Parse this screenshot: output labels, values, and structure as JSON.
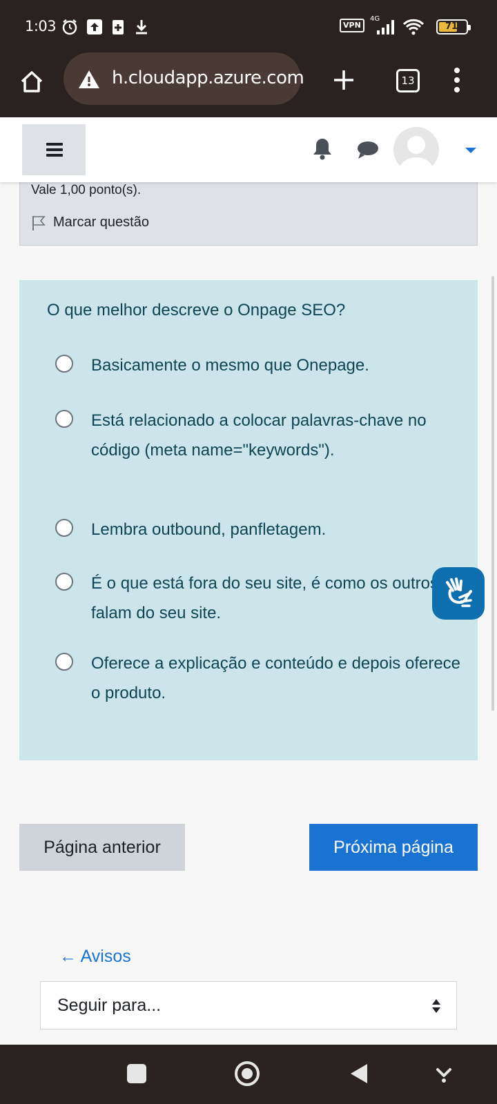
{
  "status_bar": {
    "time": "1:03",
    "vpn_label": "VPN",
    "network": "4G",
    "battery": "71",
    "icons": [
      "alarm-icon",
      "upload-icon",
      "sim-icon",
      "download-icon",
      "signal-icon",
      "wifi-icon",
      "battery-icon"
    ]
  },
  "browser": {
    "url": "h.cloudapp.azure.com",
    "tab_count": "13",
    "icons": [
      "home-icon",
      "warning-icon",
      "plus-icon",
      "more-icon"
    ]
  },
  "navbar": {
    "icons": [
      "hamburger-icon",
      "bell-icon",
      "chat-icon",
      "avatar",
      "caret-down-icon"
    ]
  },
  "question_info": {
    "points": "Vale 1,00 ponto(s).",
    "flag_label": "Marcar questão"
  },
  "question": {
    "text": "O que melhor descreve o Onpage SEO?",
    "options": [
      {
        "label": "Basicamente o mesmo que Onepage."
      },
      {
        "label": "Está relacionado a colocar palavras-chave no código (meta name=\"keywords\")."
      },
      {
        "label": "Lembra outbound, panfletagem."
      },
      {
        "label": "É o que está fora do seu site, é como os outros falam do seu site."
      },
      {
        "label": "Oferece a explicação e conteúdo e depois oferece o produto."
      }
    ]
  },
  "navigation": {
    "prev_label": "Página anterior",
    "next_label": "Próxima página",
    "back_link": "← Avisos",
    "jump_select": "Seguir para..."
  },
  "accent_colors": {
    "question_bg": "#cce5ea",
    "question_text": "#0d4555",
    "primary": "#1a73d2"
  }
}
